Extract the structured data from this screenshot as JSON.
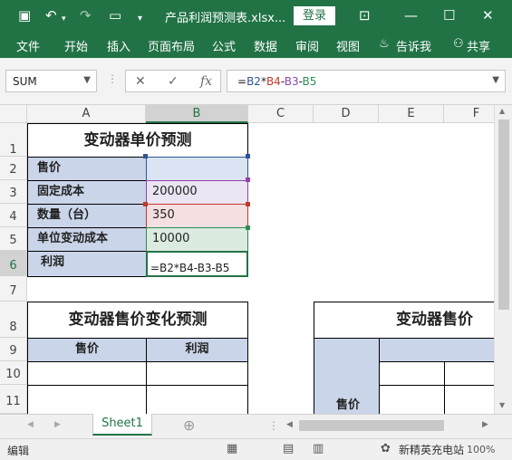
{
  "titlebar": {
    "doc_title": "产品利润预测表.xlsx...",
    "login_label": "登录"
  },
  "ribbon": {
    "tabs": [
      "文件",
      "开始",
      "插入",
      "页面布局",
      "公式",
      "数据",
      "审阅",
      "视图",
      "告诉我",
      "共享"
    ]
  },
  "formula_bar": {
    "name_box": "SUM",
    "cancel": "✕",
    "enter": "✓",
    "fx": "fx",
    "formula_parts": [
      {
        "t": "=",
        "c": "plain"
      },
      {
        "t": "B2",
        "c": "fb"
      },
      {
        "t": "*",
        "c": "plain"
      },
      {
        "t": "B4",
        "c": "fr"
      },
      {
        "t": "-",
        "c": "plain"
      },
      {
        "t": "B3",
        "c": "fv"
      },
      {
        "t": "-",
        "c": "plain"
      },
      {
        "t": "B5",
        "c": "fg"
      }
    ]
  },
  "grid": {
    "columns": [
      "A",
      "B",
      "C",
      "D",
      "E",
      "F"
    ],
    "rows": [
      "1",
      "2",
      "3",
      "4",
      "5",
      "6",
      "7",
      "8",
      "9",
      "10",
      "11"
    ],
    "table1_title": "变动器单价预测",
    "labels": {
      "price": "售价",
      "fixed_cost": "固定成本",
      "quantity": "数量（台）",
      "unit_cost": "单位变动成本",
      "profit": "利润"
    },
    "values": {
      "price": "",
      "fixed_cost": "200000",
      "quantity": "350",
      "unit_cost": "10000",
      "profit": "=B2*B4-B3-B5"
    },
    "table2_title": "变动器售价变化预测",
    "table2_headers": [
      "售价",
      "利润"
    ],
    "table3_title": "变动器售价",
    "table3_side_label": "售价"
  },
  "sheets": {
    "active": "Sheet1"
  },
  "status": {
    "mode": "编辑",
    "watermark": "新精英充电站",
    "zoom": "100%"
  }
}
